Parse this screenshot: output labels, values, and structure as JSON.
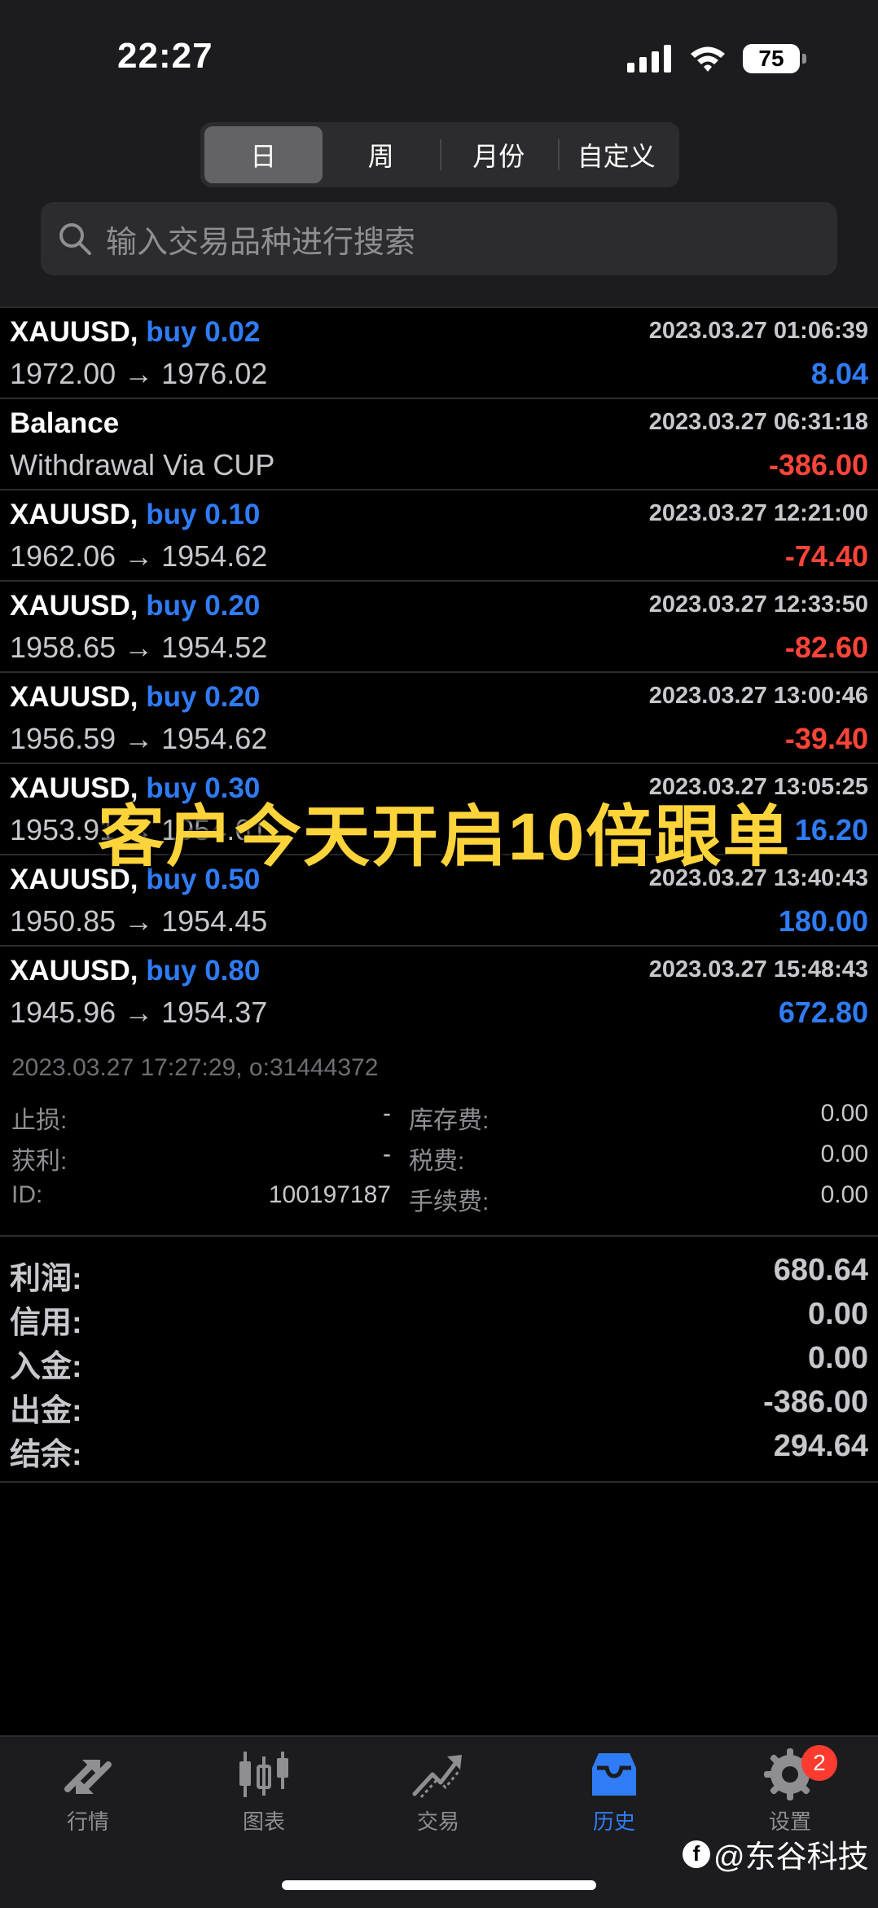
{
  "status": {
    "time": "22:27",
    "battery": "75"
  },
  "period_tabs": [
    {
      "label": "日",
      "active": true
    },
    {
      "label": "周",
      "active": false
    },
    {
      "label": "月份",
      "active": false
    },
    {
      "label": "自定义",
      "active": false
    }
  ],
  "search": {
    "placeholder": "输入交易品种进行搜索"
  },
  "deals": [
    {
      "symbol": "XAUUSD,",
      "side": "buy 0.02",
      "time": "2023.03.27 01:06:39",
      "prices": "1972.00 → 1976.02",
      "profit": "8.04",
      "sign": "pos"
    },
    {
      "symbol": "Balance",
      "side": "",
      "time": "2023.03.27 06:31:18",
      "prices": "Withdrawal Via CUP",
      "profit": "-386.00",
      "sign": "neg"
    },
    {
      "symbol": "XAUUSD,",
      "side": "buy 0.10",
      "time": "2023.03.27 12:21:00",
      "prices": "1962.06 → 1954.62",
      "profit": "-74.40",
      "sign": "neg"
    },
    {
      "symbol": "XAUUSD,",
      "side": "buy 0.20",
      "time": "2023.03.27 12:33:50",
      "prices": "1958.65 → 1954.52",
      "profit": "-82.60",
      "sign": "neg"
    },
    {
      "symbol": "XAUUSD,",
      "side": "buy 0.20",
      "time": "2023.03.27 13:00:46",
      "prices": "1956.59 → 1954.62",
      "profit": "-39.40",
      "sign": "neg"
    },
    {
      "symbol": "XAUUSD,",
      "side": "buy 0.30",
      "time": "2023.03.27 13:05:25",
      "prices": "1953.91 → 1954.61",
      "profit": "16.20",
      "sign": "pos"
    },
    {
      "symbol": "XAUUSD,",
      "side": "buy 0.50",
      "time": "2023.03.27 13:40:43",
      "prices": "1950.85 → 1954.45",
      "profit": "180.00",
      "sign": "pos"
    },
    {
      "symbol": "XAUUSD,",
      "side": "buy 0.80",
      "time": "2023.03.27 15:48:43",
      "prices": "1945.96 → 1954.37",
      "profit": "672.80",
      "sign": "pos"
    }
  ],
  "order_detail": {
    "line": "2023.03.27 17:27:29, o:31444372",
    "rows": [
      {
        "k1": "止损:",
        "v1": "-",
        "k2": "库存费:",
        "v2": "0.00"
      },
      {
        "k1": "获利:",
        "v1": "-",
        "k2": "税费:",
        "v2": "0.00"
      },
      {
        "k1": "ID:",
        "v1": "100197187",
        "k2": "手续费:",
        "v2": "0.00"
      }
    ]
  },
  "summary": [
    {
      "label": "利润:",
      "value": "680.64"
    },
    {
      "label": "信用:",
      "value": "0.00"
    },
    {
      "label": "入金:",
      "value": "0.00"
    },
    {
      "label": "出金:",
      "value": "-386.00"
    },
    {
      "label": "结余:",
      "value": "294.64"
    }
  ],
  "overlay_caption": "客户今天开启10倍跟单",
  "tabbar": [
    {
      "label": "行情",
      "icon": "quotes-arrows-icon",
      "active": false
    },
    {
      "label": "图表",
      "icon": "candlestick-chart-icon",
      "active": false
    },
    {
      "label": "交易",
      "icon": "trade-trend-icon",
      "active": false
    },
    {
      "label": "历史",
      "icon": "history-inbox-icon",
      "active": true
    },
    {
      "label": "设置",
      "icon": "settings-gear-icon",
      "active": false,
      "badge": "2"
    }
  ],
  "watermark": "@东谷科技",
  "colors": {
    "profit": "#2f7cf6",
    "loss": "#ff453a",
    "caption": "#ffd43a",
    "active_tab": "#2f7cf6"
  }
}
